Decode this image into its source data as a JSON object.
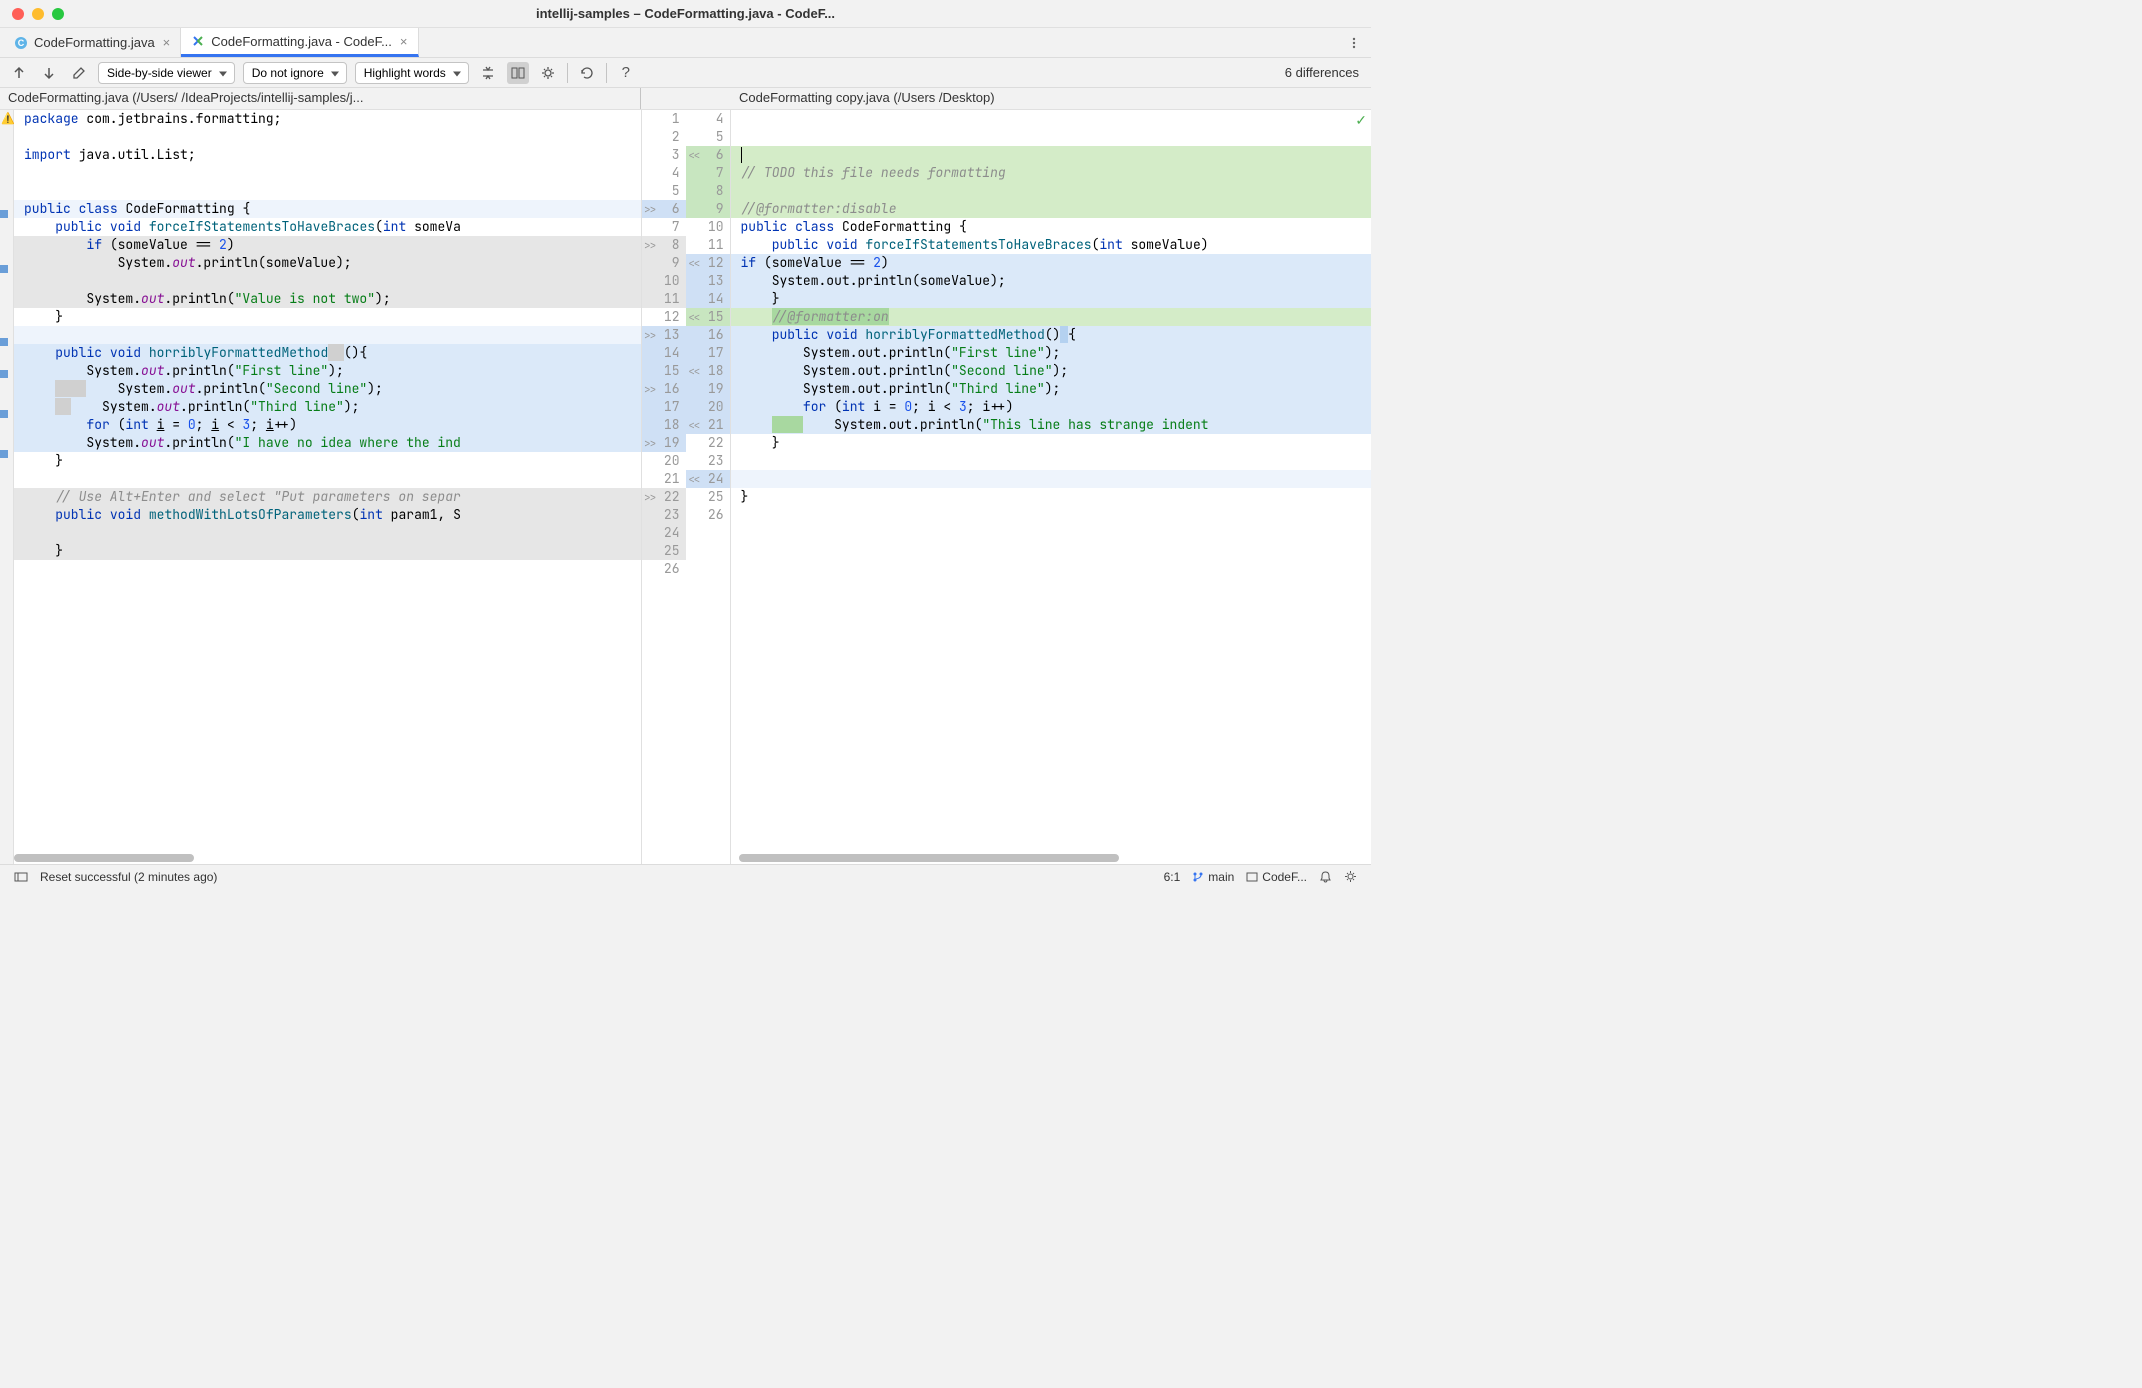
{
  "window": {
    "title": "intellij-samples – CodeFormatting.java - CodeF..."
  },
  "tabs": [
    {
      "label": "CodeFormatting.java",
      "active": false
    },
    {
      "label": "CodeFormatting.java - CodeF...",
      "active": true
    }
  ],
  "toolbar": {
    "viewer_mode": "Side-by-side viewer",
    "ignore_mode": "Do not ignore",
    "highlight_mode": "Highlight words",
    "diff_count": "6 differences"
  },
  "paths": {
    "left": "CodeFormatting.java (/Users/                              /IdeaProjects/intellij-samples/j...",
    "right": "CodeFormatting copy.java (/Users /Desktop)"
  },
  "left_code": [
    {
      "n": 1,
      "bg": "",
      "html": "<span class='kw'>package</span> com.jetbrains.formatting;"
    },
    {
      "n": 2,
      "bg": "",
      "html": ""
    },
    {
      "n": 3,
      "bg": "",
      "html": "<span class='kw'>import</span> java.util.List;"
    },
    {
      "n": 4,
      "bg": "",
      "html": ""
    },
    {
      "n": 5,
      "bg": "",
      "html": ""
    },
    {
      "n": 6,
      "bg": "lblue",
      "marker": ">>",
      "html": "<span class='kw'>public</span> <span class='kw'>class</span> <span class='type'>CodeFormatting</span> {"
    },
    {
      "n": 7,
      "bg": "",
      "html": "    <span class='kw'>public</span> <span class='kw'>void</span> <span class='method'>forceIfStatementsToHaveBraces</span>(<span class='kw'>int</span> someVa"
    },
    {
      "n": 8,
      "bg": "gray",
      "marker": ">>",
      "html": "        <span class='kw'>if</span> (someValue == <span class='num'>2</span>)"
    },
    {
      "n": 9,
      "bg": "gray",
      "html": "            System.<span class='field'>out</span>.println(someValue);"
    },
    {
      "n": 10,
      "bg": "gray",
      "html": ""
    },
    {
      "n": 11,
      "bg": "gray",
      "html": "        System.<span class='field'>out</span>.println(<span class='str'>\"Value is not two\"</span>);"
    },
    {
      "n": 12,
      "bg": "",
      "html": "    }"
    },
    {
      "n": 13,
      "bg": "lblue",
      "marker": ">>",
      "html": ""
    },
    {
      "n": 14,
      "bg": "blue",
      "html": "    <span class='kw'>public</span> <span class='kw'>void</span> <span class='method'>horriblyFormattedMethod</span><span class='hl-gray'>  </span>(){"
    },
    {
      "n": 15,
      "bg": "blue",
      "html": "        System.<span class='field'>out</span>.println(<span class='str'>\"First line\"</span>);"
    },
    {
      "n": 16,
      "bg": "blue",
      "marker": ">>",
      "html": "    <span class='hl-gray'>    </span>    System.<span class='field'>out</span>.println(<span class='str'>\"Second line\"</span>);"
    },
    {
      "n": 17,
      "bg": "blue",
      "html": "    <span class='hl-gray'>  </span>    System.<span class='field'>out</span>.println(<span class='str'>\"Third line\"</span>);"
    },
    {
      "n": 18,
      "bg": "blue",
      "html": "        <span class='kw'>for</span> (<span class='kw'>int</span> <u>i</u> = <span class='num'>0</span>; <u>i</u> &lt; <span class='num'>3</span>; <u>i</u>++)"
    },
    {
      "n": 19,
      "bg": "blue",
      "marker": ">>",
      "html": "        System.<span class='field'>out</span>.println(<span class='str'>\"I have no idea where the ind</span>"
    },
    {
      "n": 20,
      "bg": "",
      "html": "    }"
    },
    {
      "n": 21,
      "bg": "",
      "html": ""
    },
    {
      "n": 22,
      "bg": "gray",
      "marker": ">>",
      "html": "    <span class='comment'>// Use Alt+Enter and select \"Put parameters on separ</span>"
    },
    {
      "n": 23,
      "bg": "gray",
      "html": "    <span class='kw'>public</span> <span class='kw'>void</span> <span class='method'>methodWithLotsOfParameters</span>(<span class='kw'>int</span> param1, S"
    },
    {
      "n": 24,
      "bg": "gray",
      "html": ""
    },
    {
      "n": 25,
      "bg": "gray",
      "html": "    }"
    },
    {
      "n": 26,
      "bg": "",
      "html": ""
    }
  ],
  "right_code": [
    {
      "n": 4,
      "bg": "",
      "html": ""
    },
    {
      "n": 5,
      "bg": "",
      "html": ""
    },
    {
      "n": 6,
      "bg": "green",
      "marker": "<<",
      "html": "<span class='cursor'></span>"
    },
    {
      "n": 7,
      "bg": "green",
      "html": "<span class='comment'>// TODO this file needs formatting</span>"
    },
    {
      "n": 8,
      "bg": "green",
      "html": ""
    },
    {
      "n": 9,
      "bg": "green",
      "html": "<span class='comment'>//@formatter:disable</span>"
    },
    {
      "n": 10,
      "bg": "",
      "html": "<span class='kw'>public</span> <span class='kw'>class</span> <span class='type'>CodeFormatting</span> {"
    },
    {
      "n": 11,
      "bg": "",
      "html": "    <span class='kw'>public</span> <span class='kw'>void</span> <span class='method'>forceIfStatementsToHaveBraces</span>(<span class='kw'>int</span> someValue)"
    },
    {
      "n": 12,
      "bg": "blue",
      "marker": "<<",
      "html": "<span class='kw'>if</span> (someValue == <span class='num'>2</span>)"
    },
    {
      "n": 13,
      "bg": "blue",
      "html": "    System.out.println(someValue);"
    },
    {
      "n": 14,
      "bg": "blue",
      "html": "    }"
    },
    {
      "n": 15,
      "bg": "green",
      "marker": "<<",
      "html": "    <span class='hl-green comment'>//@formatter:on</span>"
    },
    {
      "n": 16,
      "bg": "blue",
      "html": "    <span class='kw'>public</span> <span class='kw'>void</span> <span class='method'>horriblyFormattedMethod</span>()<span class='hl-blue'> </span>{"
    },
    {
      "n": 17,
      "bg": "blue",
      "html": "        System.out.println(<span class='str'>\"First line\"</span>);"
    },
    {
      "n": 18,
      "bg": "blue",
      "marker": "<<",
      "html": "        System.out.println(<span class='str'>\"Second line\"</span>);"
    },
    {
      "n": 19,
      "bg": "blue",
      "html": "        System.out.println(<span class='str'>\"Third line\"</span>);"
    },
    {
      "n": 20,
      "bg": "blue",
      "html": "        <span class='kw'>for</span> (<span class='kw'>int</span> i = <span class='num'>0</span>; i &lt; <span class='num'>3</span>; i++)"
    },
    {
      "n": 21,
      "bg": "blue",
      "marker": "<<",
      "html": "    <span class='hl-green'>    </span>    System.out.println(<span class='str'>\"This line has strange indent</span>"
    },
    {
      "n": 22,
      "bg": "",
      "html": "    }"
    },
    {
      "n": 23,
      "bg": "",
      "html": ""
    },
    {
      "n": 24,
      "bg": "lblue",
      "marker": "<<",
      "html": ""
    },
    {
      "n": 25,
      "bg": "",
      "html": "}"
    },
    {
      "n": 26,
      "bg": "",
      "html": ""
    }
  ],
  "status": {
    "message": "Reset successful (2 minutes ago)",
    "cursor": "6:1",
    "branch": "main",
    "vcs_label": "CodeF..."
  }
}
